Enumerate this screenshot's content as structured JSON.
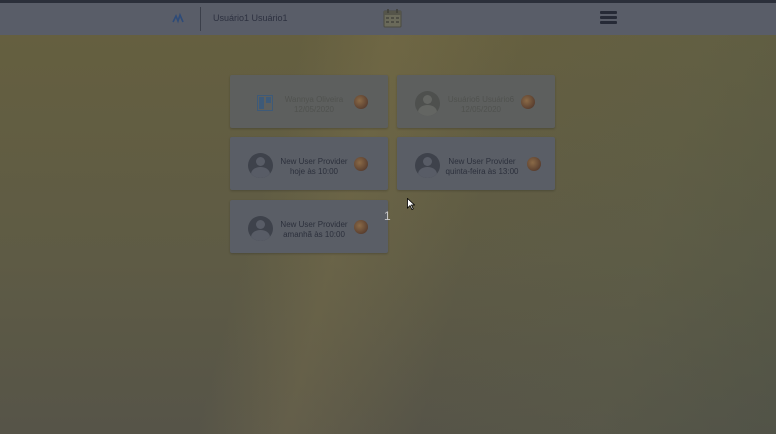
{
  "header": {
    "logo_icon": "brand-logo-icon",
    "username": "Usuário1 Usuário1",
    "calendar_icon": "calendar-icon",
    "menu_icon": "hamburger-menu-icon"
  },
  "cards": [
    {
      "name": "Wannya Oliveira",
      "when": "12/05/2020",
      "dim": true
    },
    {
      "name": "Usuário6 Usuário6",
      "when": "12/05/2020",
      "dim": true
    },
    {
      "name": "New User Provider",
      "when": "hoje às 10:00",
      "dim": false
    },
    {
      "name": "New User Provider",
      "when": "quinta-feira às 13:00",
      "dim": false
    },
    {
      "name": "New User Provider",
      "when": "amanhã às 10:00",
      "dim": false
    }
  ],
  "pagination": {
    "page": "1"
  },
  "colors": {
    "overlay_bg": "#5f5c47",
    "header_bg": "#595d68",
    "card_bg": "#5a5e66"
  }
}
